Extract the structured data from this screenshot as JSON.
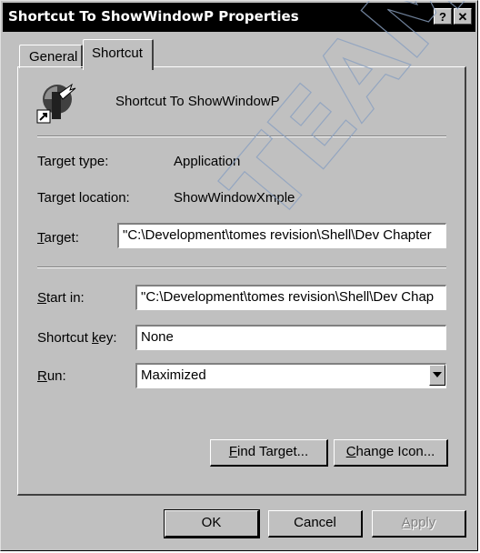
{
  "window": {
    "title": "Shortcut To ShowWindowP Properties",
    "help_button": "?",
    "close_button": "✕"
  },
  "tabs": [
    {
      "label": "General",
      "selected": false
    },
    {
      "label": "Shortcut",
      "selected": true
    }
  ],
  "shortcut": {
    "name": "Shortcut To ShowWindowP",
    "icon": "shortcut-app-icon",
    "target_type_label": "Target type:",
    "target_type_value": "Application",
    "target_location_label": "Target location:",
    "target_location_value": "ShowWindowXmple",
    "target_label_key": "T",
    "target_label_rest": "arget:",
    "target_value": "\"C:\\Development\\tomes revision\\Shell\\Dev Chapter",
    "start_in_label_key": "S",
    "start_in_label_rest": "tart in:",
    "start_in_value": "\"C:\\Development\\tomes revision\\Shell\\Dev Chap",
    "shortcut_key_label_pre": "Shortcut ",
    "shortcut_key_label_key": "k",
    "shortcut_key_label_post": "ey:",
    "shortcut_key_value": "None",
    "run_label_key": "R",
    "run_label_rest": "un:",
    "run_value": "Maximized"
  },
  "buttons": {
    "find_target_key": "F",
    "find_target_rest": "ind Target...",
    "change_icon_key": "C",
    "change_icon_rest": "hange Icon...",
    "ok": "OK",
    "cancel": "Cancel",
    "apply_key": "A",
    "apply_rest": "pply",
    "apply_enabled": false
  },
  "watermark": {
    "text": "TEAM"
  }
}
